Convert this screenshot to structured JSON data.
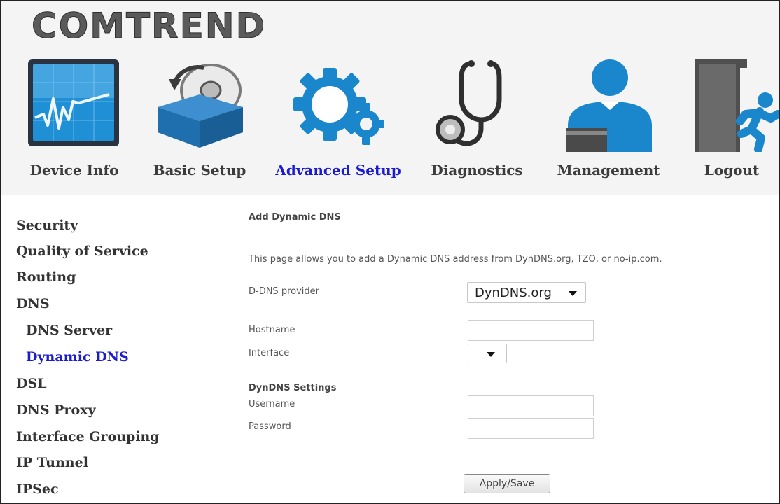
{
  "brand": {
    "logo_text": "COMTREND"
  },
  "nav": {
    "items": [
      {
        "label": "Device Info",
        "icon": "device-info-monitor-icon"
      },
      {
        "label": "Basic Setup",
        "icon": "basic-setup-box-disc-icon"
      },
      {
        "label": "Advanced Setup",
        "icon": "advanced-setup-gears-icon",
        "active": true
      },
      {
        "label": "Diagnostics",
        "icon": "diagnostics-stethoscope-icon"
      },
      {
        "label": "Management",
        "icon": "management-person-icon"
      },
      {
        "label": "Logout",
        "icon": "logout-running-man-icon"
      }
    ]
  },
  "sidebar": {
    "items": [
      {
        "label": "Security"
      },
      {
        "label": "Quality of Service"
      },
      {
        "label": "Routing"
      },
      {
        "label": "DNS"
      },
      {
        "label": "DNS Server"
      },
      {
        "label": "Dynamic DNS",
        "active": true
      },
      {
        "label": "DSL"
      },
      {
        "label": "DNS Proxy"
      },
      {
        "label": "Interface Grouping"
      },
      {
        "label": "IP Tunnel"
      },
      {
        "label": "IPSec"
      }
    ]
  },
  "form": {
    "title": "Add Dynamic DNS",
    "description": "This page allows you to add a Dynamic DNS address from DynDNS.org, TZO, or no-ip.com.",
    "provider_label": "D-DNS provider",
    "provider_value": "DynDNS.org",
    "hostname_label": "Hostname",
    "hostname_value": "",
    "interface_label": "Interface",
    "interface_value": "",
    "section_title": "DynDNS Settings",
    "username_label": "Username",
    "username_value": "",
    "password_label": "Password",
    "password_value": "",
    "apply_label": "Apply/Save"
  },
  "colors": {
    "active_link": "#1b1bd0",
    "header_bg": "#f4f4f4",
    "icon_blue": "#1a86cc"
  }
}
